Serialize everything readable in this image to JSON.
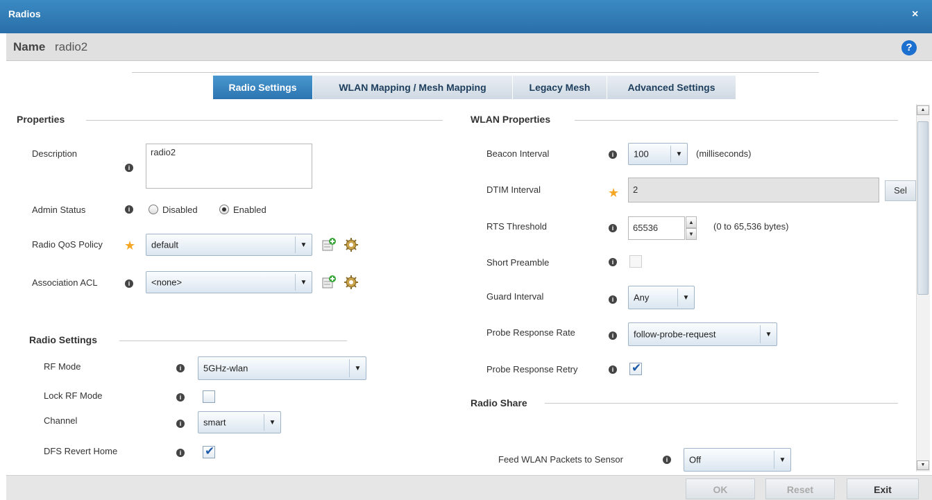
{
  "window": {
    "title": "Radios",
    "close_symbol": "×"
  },
  "namebar": {
    "label": "Name",
    "value": "radio2",
    "help_symbol": "?"
  },
  "tabs": [
    {
      "label": "Radio Settings",
      "active": true
    },
    {
      "label": "WLAN Mapping / Mesh Mapping",
      "active": false
    },
    {
      "label": "Legacy Mesh",
      "active": false
    },
    {
      "label": "Advanced Settings",
      "active": false
    }
  ],
  "properties": {
    "heading": "Properties",
    "description_label": "Description",
    "description_value": "radio2",
    "admin_status_label": "Admin Status",
    "admin_disabled": "Disabled",
    "admin_enabled": "Enabled",
    "qos_label": "Radio QoS Policy",
    "qos_value": "default",
    "acl_label": "Association ACL",
    "acl_value": "<none>"
  },
  "radio_settings": {
    "heading": "Radio Settings",
    "rf_mode_label": "RF Mode",
    "rf_mode_value": "5GHz-wlan",
    "lock_rf_label": "Lock RF Mode",
    "channel_label": "Channel",
    "channel_value": "smart",
    "dfs_label": "DFS Revert Home"
  },
  "wlan_properties": {
    "heading": "WLAN Properties",
    "beacon_label": "Beacon Interval",
    "beacon_value": "100",
    "beacon_unit": "(milliseconds)",
    "dtim_label": "DTIM Interval",
    "dtim_value": "2",
    "dtim_button": "Sel",
    "rts_label": "RTS Threshold",
    "rts_value": "65536",
    "rts_unit": "(0 to 65,536 bytes)",
    "short_preamble_label": "Short Preamble",
    "guard_label": "Guard Interval",
    "guard_value": "Any",
    "probe_rate_label": "Probe Response Rate",
    "probe_rate_value": "follow-probe-request",
    "probe_retry_label": "Probe Response Retry"
  },
  "radio_share": {
    "heading": "Radio Share",
    "feed_label": "Feed WLAN Packets to Sensor",
    "feed_value": "Off"
  },
  "footer": {
    "ok": "OK",
    "reset": "Reset",
    "exit": "Exit"
  },
  "icons": {
    "info": "i",
    "required": "★",
    "dropdown": "▼",
    "spin_up": "▲",
    "spin_down": "▼"
  },
  "colors": {
    "title_bar": "#2a6fa8",
    "active_tab": "#2b74b0",
    "required_star": "#f5a623"
  }
}
